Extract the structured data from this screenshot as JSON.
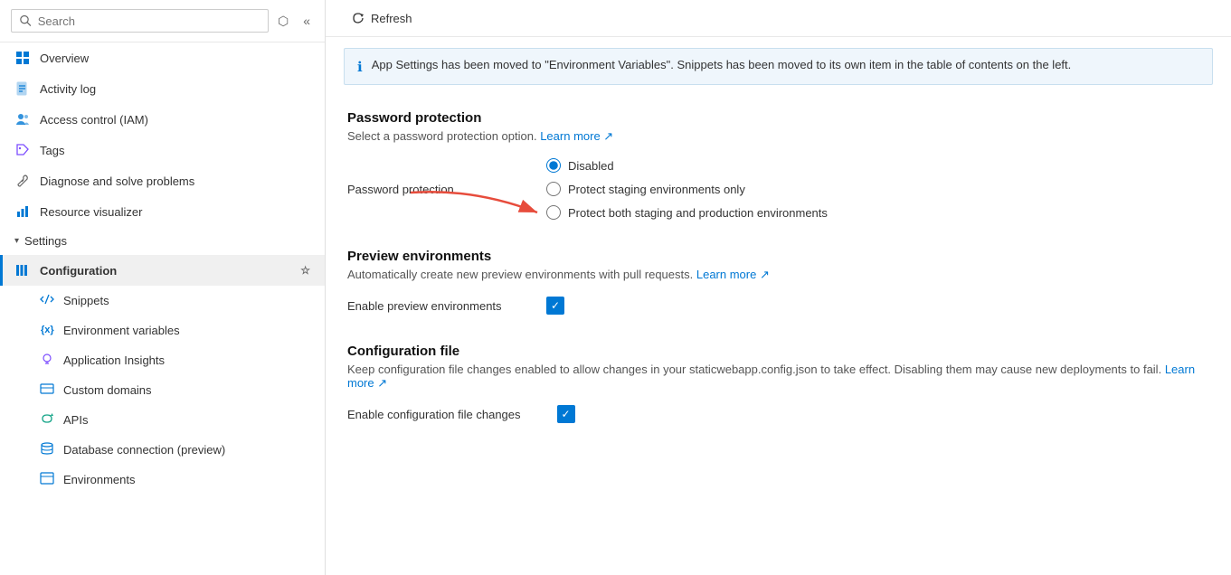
{
  "sidebar": {
    "search_placeholder": "Search",
    "items": [
      {
        "id": "overview",
        "label": "Overview",
        "icon": "grid",
        "color": "#0078d4",
        "level": 0
      },
      {
        "id": "activity-log",
        "label": "Activity log",
        "icon": "doc",
        "color": "#0078d4",
        "level": 0
      },
      {
        "id": "access-control",
        "label": "Access control (IAM)",
        "icon": "people",
        "color": "#0078d4",
        "level": 0
      },
      {
        "id": "tags",
        "label": "Tags",
        "icon": "tag",
        "color": "#7c4dff",
        "level": 0
      },
      {
        "id": "diagnose",
        "label": "Diagnose and solve problems",
        "icon": "wrench",
        "color": "#555",
        "level": 0
      },
      {
        "id": "resource-visualizer",
        "label": "Resource visualizer",
        "icon": "chart",
        "color": "#0078d4",
        "level": 0
      },
      {
        "id": "settings",
        "label": "Settings",
        "icon": "chevron",
        "level": 0,
        "section": true
      },
      {
        "id": "configuration",
        "label": "Configuration",
        "icon": "columns",
        "color": "#0078d4",
        "level": 1,
        "active": true
      },
      {
        "id": "snippets",
        "label": "Snippets",
        "icon": "code",
        "color": "#0078d4",
        "level": 2
      },
      {
        "id": "env-variables",
        "label": "Environment variables",
        "icon": "env",
        "color": "#0078d4",
        "level": 2
      },
      {
        "id": "app-insights",
        "label": "Application Insights",
        "icon": "bulb",
        "color": "#7c4dff",
        "level": 2
      },
      {
        "id": "custom-domains",
        "label": "Custom domains",
        "icon": "domains",
        "color": "#0078d4",
        "level": 2
      },
      {
        "id": "apis",
        "label": "APIs",
        "icon": "loop",
        "color": "#17a589",
        "level": 2
      },
      {
        "id": "database",
        "label": "Database connection (preview)",
        "icon": "db",
        "color": "#0078d4",
        "level": 2
      },
      {
        "id": "environments",
        "label": "Environments",
        "icon": "env2",
        "color": "#0078d4",
        "level": 2
      }
    ]
  },
  "toolbar": {
    "refresh_label": "Refresh"
  },
  "info_banner": {
    "text": "App Settings has been moved to \"Environment Variables\". Snippets has been moved to its own item in the table of contents on the left."
  },
  "password_protection": {
    "title": "Password protection",
    "description": "Select a password protection option.",
    "learn_more": "Learn more",
    "field_label": "Password protection",
    "options": [
      {
        "id": "disabled",
        "label": "Disabled",
        "selected": true
      },
      {
        "id": "staging",
        "label": "Protect staging environments only",
        "selected": false
      },
      {
        "id": "both",
        "label": "Protect both staging and production environments",
        "selected": false
      }
    ]
  },
  "preview_environments": {
    "title": "Preview environments",
    "description": "Automatically create new preview environments with pull requests.",
    "learn_more": "Learn more",
    "field_label": "Enable preview environments",
    "enabled": true
  },
  "config_file": {
    "title": "Configuration file",
    "description": "Keep configuration file changes enabled to allow changes in your staticwebapp.config.json to take effect. Disabling them may cause new deployments to fail.",
    "learn_more": "Learn more",
    "field_label": "Enable configuration file changes",
    "enabled": true
  }
}
